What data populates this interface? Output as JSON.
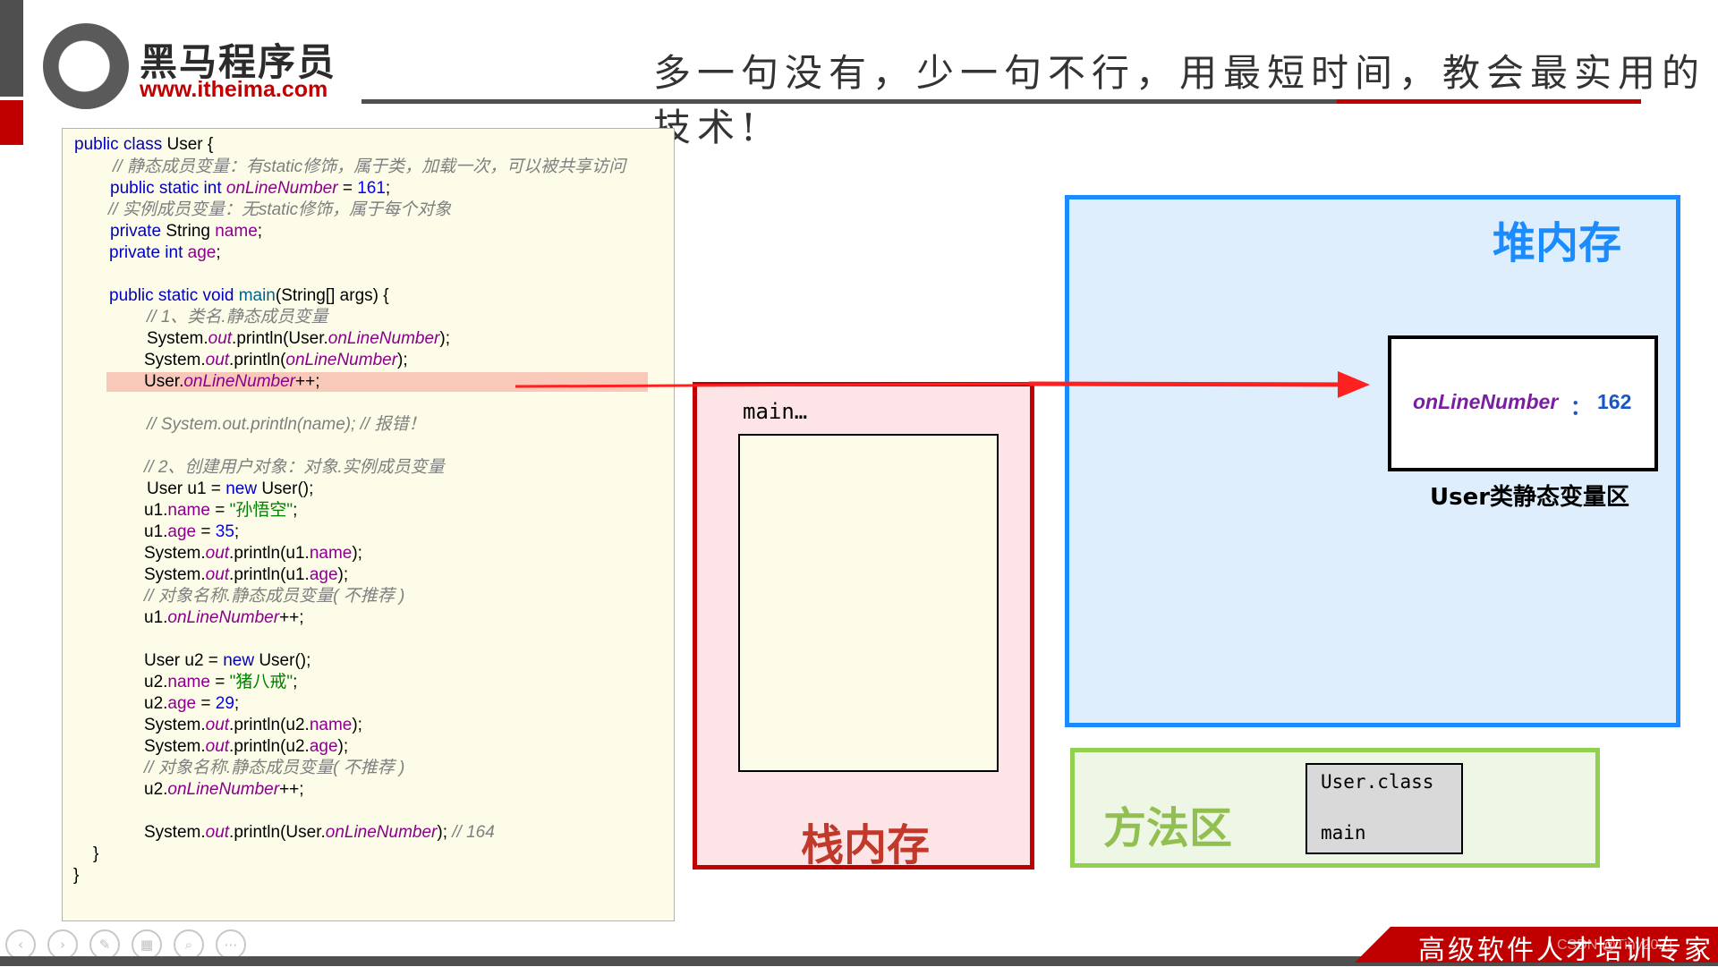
{
  "header": {
    "brand_name": "黑马程序员",
    "brand_url": "www.itheima.com",
    "slogan": "多一句没有，少一句不行，用最短时间，教会最实用的技术!"
  },
  "code": {
    "l1_a": "public class ",
    "l1_b": "User {",
    "l2": "// 静态成员变量：有static修饰，属于类，加载一次，可以被共享访问",
    "l3_a": "public static int ",
    "l3_b": "onLineNumber",
    "l3_c": " = ",
    "l3_d": "161",
    "l3_e": ";",
    "l4": "// 实例成员变量：无static修饰，属于每个对象",
    "l5_a": "private ",
    "l5_b": "String ",
    "l5_c": "name",
    "l5_d": ";",
    "l6_a": "private int ",
    "l6_b": "age",
    "l6_c": ";",
    "l7_a": "public static void ",
    "l7_b": "main",
    "l7_c": "(String[] args) {",
    "l8": "// 1、类名.静态成员变量",
    "l9_a": "System.",
    "l9_b": "out",
    "l9_c": ".println(User.",
    "l9_d": "onLineNumber",
    "l9_e": ");",
    "l10_a": "System.",
    "l10_b": "out",
    "l10_c": ".println(",
    "l10_d": "onLineNumber",
    "l10_e": ");",
    "l11_a": "User.",
    "l11_b": "onLineNumber",
    "l11_c": "++;",
    "l12": "// System.out.println(name); // 报错！",
    "l13": "// 2、创建用户对象：对象.实例成员变量",
    "l14_a": "User u1 = ",
    "l14_b": "new ",
    "l14_c": "User();",
    "l15_a": "u1.",
    "l15_b": "name",
    "l15_c": " = ",
    "l15_d": "\"孙悟空\"",
    "l15_e": ";",
    "l16_a": "u1.",
    "l16_b": "age",
    "l16_c": " = ",
    "l16_d": "35",
    "l16_e": ";",
    "l17_a": "System.",
    "l17_b": "out",
    "l17_c": ".println(u1.",
    "l17_d": "name",
    "l17_e": ");",
    "l18_a": "System.",
    "l18_b": "out",
    "l18_c": ".println(u1.",
    "l18_d": "age",
    "l18_e": ");",
    "l19": "// 对象名称.静态成员变量( 不推荐 )",
    "l20_a": "u1.",
    "l20_b": "onLineNumber",
    "l20_c": "++;",
    "l21_a": "User u2 = ",
    "l21_b": "new ",
    "l21_c": "User();",
    "l22_a": "u2.",
    "l22_b": "name",
    "l22_c": " = ",
    "l22_d": "\"猪八戒\"",
    "l22_e": ";",
    "l23_a": "u2.",
    "l23_b": "age",
    "l23_c": " = ",
    "l23_d": "29",
    "l23_e": ";",
    "l24_a": "System.",
    "l24_b": "out",
    "l24_c": ".println(u2.",
    "l24_d": "name",
    "l24_e": ");",
    "l25_a": "System.",
    "l25_b": "out",
    "l25_c": ".println(u2.",
    "l25_d": "age",
    "l25_e": ");",
    "l26": "// 对象名称.静态成员变量( 不推荐 )",
    "l27_a": "u2.",
    "l27_b": "onLineNumber",
    "l27_c": "++;",
    "l28_a": "System.",
    "l28_b": "out",
    "l28_c": ".println(User.",
    "l28_d": "onLineNumber",
    "l28_e": "); ",
    "l28_f": "// 164",
    "l29": "}",
    "l30": "}"
  },
  "stack": {
    "frame_label": "main…",
    "title": "栈内存"
  },
  "heap": {
    "title": "堆内存",
    "static_field": "onLineNumber",
    "static_colon": "：",
    "static_value": "162",
    "static_caption": "User类静态变量区"
  },
  "method_area": {
    "title": "方法区",
    "class_name": "User.class",
    "method": "main"
  },
  "toolbar": {
    "prev_icon": "‹",
    "next_icon": "›",
    "pen_icon": "✎",
    "slides_icon": "▦",
    "zoom_icon": "⌕",
    "more_icon": "⋯"
  },
  "footer": {
    "banner_text": "高级软件人才培训专家",
    "watermark": "CSDN @Tiny2021"
  },
  "colors": {
    "brand_red": "#c00000",
    "heap_blue": "#1a8cff",
    "stack_red": "#c00000",
    "method_green": "#92d050",
    "code_bg": "#fcfce8",
    "keyword": "#0000c0",
    "field": "#8b008b",
    "comment": "#7f7f7f",
    "string": "#008000"
  }
}
